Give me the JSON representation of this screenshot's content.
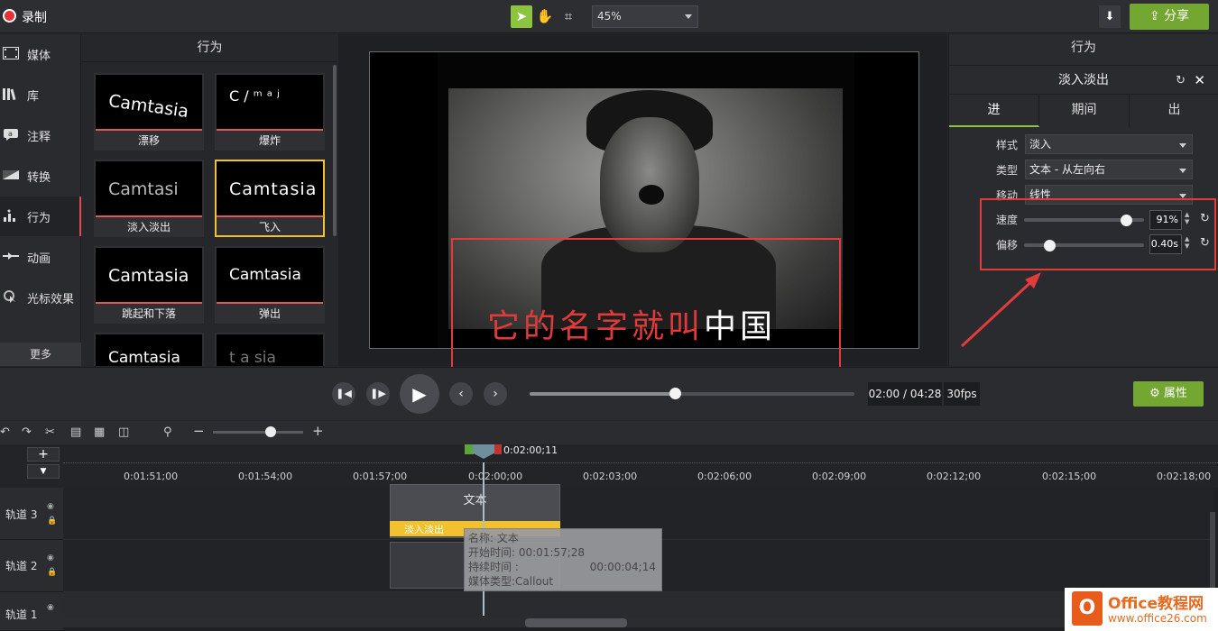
{
  "topbar": {
    "record_label": "录制",
    "zoom_value": "45%",
    "share_label": "分享"
  },
  "sidebar": {
    "items": [
      {
        "label": "媒体",
        "icon": "film-icon"
      },
      {
        "label": "库",
        "icon": "library-icon"
      },
      {
        "label": "注释",
        "icon": "annotation-icon"
      },
      {
        "label": "转换",
        "icon": "transition-icon"
      },
      {
        "label": "行为",
        "icon": "behavior-icon"
      },
      {
        "label": "动画",
        "icon": "animation-icon"
      },
      {
        "label": "光标效果",
        "icon": "cursor-icon"
      }
    ],
    "more_label": "更多"
  },
  "behaviors": {
    "title": "行为",
    "items": [
      {
        "label": "漂移",
        "preview": "Camtasia"
      },
      {
        "label": "爆炸",
        "preview": "C ∕ ᵐ ᵃ ʲ"
      },
      {
        "label": "淡入淡出",
        "preview": "Camtasi"
      },
      {
        "label": "飞入",
        "preview": "Camtasia"
      },
      {
        "label": "跳起和下落",
        "preview": "Camtasia"
      },
      {
        "label": "弹出",
        "preview": "Camtasia"
      },
      {
        "label": "",
        "preview": "Camtasia"
      },
      {
        "label": "",
        "preview": "t a sia"
      }
    ]
  },
  "preview": {
    "subtitle_red": "它的名字就叫",
    "subtitle_white": "中国"
  },
  "properties": {
    "title": "行为",
    "effect_name": "淡入淡出",
    "tabs": [
      "进",
      "期间",
      "出"
    ],
    "style_label": "样式",
    "style_value": "淡入",
    "type_label": "类型",
    "type_value": "文本 - 从左向右",
    "move_label": "移动",
    "move_value": "线性",
    "speed_label": "速度",
    "speed_value": "91%",
    "offset_label": "偏移",
    "offset_value": "0.40s"
  },
  "transport": {
    "time": "02:00 / 04:28",
    "fps": "30fps",
    "props_label": "属性",
    "progress": 0.45
  },
  "timeline": {
    "playhead_time": "0:02:00;11",
    "ticks": [
      "0:01:51;00",
      "0:01:54;00",
      "0:01:57;00",
      "0:02:00;00",
      "0:02:03;00",
      "0:02:06;00",
      "0:02:09;00",
      "0:02:12;00",
      "0:02:15;00",
      "0:02:18;00"
    ],
    "tracks": [
      "轨道 3",
      "轨道 2",
      "轨道 1"
    ],
    "clip_text": "文本",
    "clip_effect": "淡入淡出",
    "tooltip": {
      "name": "名称: 文本",
      "start": "开始时间: 00:01:57;28",
      "duration_label": "持续时间 :",
      "duration_value": "00:00:04;14",
      "type": "媒体类型:Callout"
    }
  },
  "watermark": {
    "brand": "Office教程网",
    "url": "www.office26.com"
  }
}
